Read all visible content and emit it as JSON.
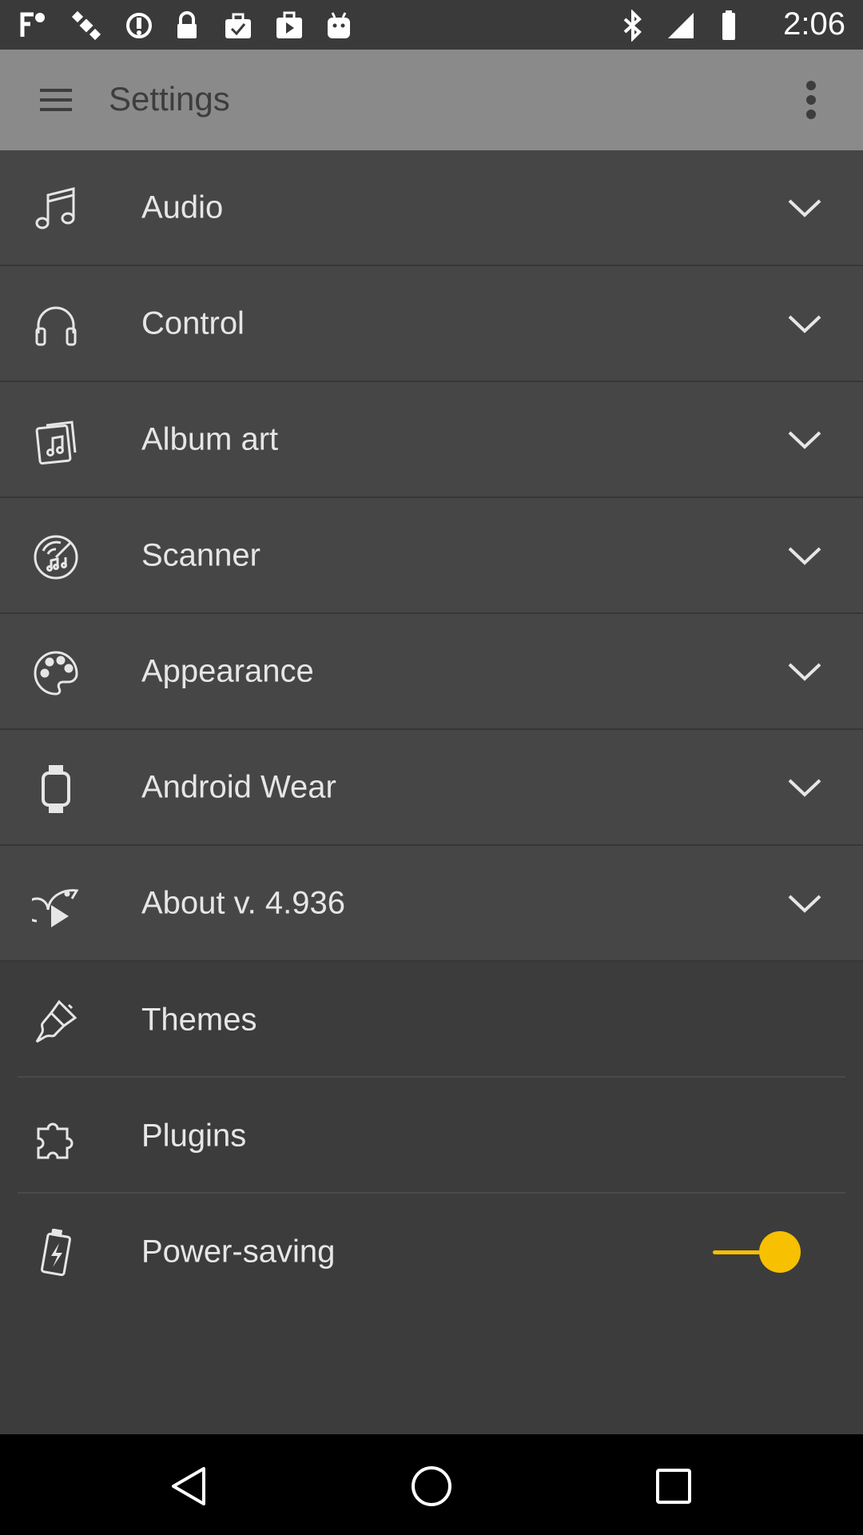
{
  "status_bar": {
    "time": "2:06",
    "left_icons": [
      "fake-gps-icon",
      "satellite-icon",
      "sync-icon",
      "lock-icon",
      "briefcase-check-icon",
      "play-store-icon",
      "android-icon"
    ],
    "right_icons": [
      "bluetooth-icon",
      "signal-icon",
      "battery-icon"
    ]
  },
  "app_bar": {
    "title": "Settings",
    "menu_icon": "hamburger-menu-icon",
    "overflow_icon": "more-vert-icon"
  },
  "settings": {
    "expandable": [
      {
        "label": "Audio",
        "icon": "music-note-icon"
      },
      {
        "label": "Control",
        "icon": "headphones-icon"
      },
      {
        "label": "Album art",
        "icon": "album-art-icon"
      },
      {
        "label": "Scanner",
        "icon": "scanner-icon"
      },
      {
        "label": "Appearance",
        "icon": "palette-icon"
      },
      {
        "label": "Android Wear",
        "icon": "watch-icon"
      },
      {
        "label": "About v. 4.936",
        "icon": "chameleon-play-icon"
      }
    ],
    "plain": [
      {
        "label": "Themes",
        "icon": "brush-icon"
      },
      {
        "label": "Plugins",
        "icon": "puzzle-icon"
      },
      {
        "label": "Power-saving",
        "icon": "battery-bolt-icon",
        "toggle_on": true
      }
    ]
  },
  "colors": {
    "accent": "#f7c000",
    "app_bar": "#8a8a8a",
    "expandable_bg": "#464646",
    "page_bg": "#3c3c3c"
  },
  "nav_bar": {
    "buttons": [
      "back-icon",
      "home-icon",
      "recents-icon"
    ]
  }
}
